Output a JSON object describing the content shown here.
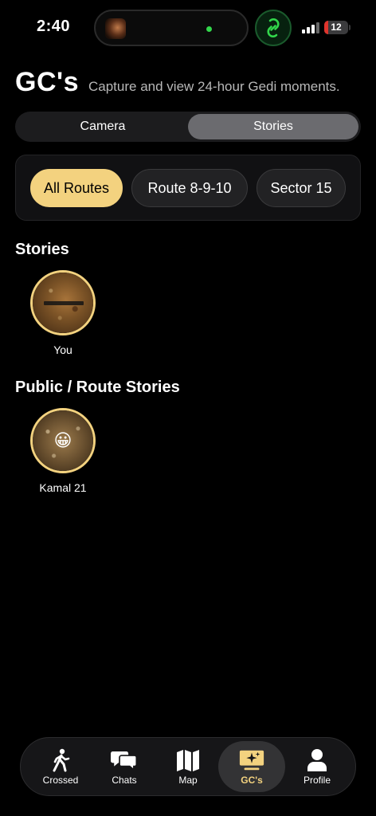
{
  "status_bar": {
    "time": "2:40",
    "battery_level": "12"
  },
  "header": {
    "title": "GC's",
    "subtitle": "Capture and view 24-hour Gedi moments."
  },
  "segmented": {
    "options": [
      "Camera",
      "Stories"
    ],
    "selected": "Stories"
  },
  "filters": {
    "items": [
      "All Routes",
      "Route 8-9-10",
      "Sector 15"
    ],
    "selected": "All Routes"
  },
  "stories_section": {
    "title": "Stories",
    "items": [
      {
        "name": "You"
      }
    ]
  },
  "public_section": {
    "title": "Public / Route Stories",
    "items": [
      {
        "name": "Kamal 21",
        "emoji": "😀"
      }
    ]
  },
  "tabbar": {
    "items": [
      {
        "label": "Crossed",
        "icon": "walking-person-icon"
      },
      {
        "label": "Chats",
        "icon": "chat-bubbles-icon"
      },
      {
        "label": "Map",
        "icon": "map-icon"
      },
      {
        "label": "GC's",
        "icon": "sparkle-screen-icon"
      },
      {
        "label": "Profile",
        "icon": "person-icon"
      }
    ],
    "selected": "GC's"
  },
  "colors": {
    "accent": "#f3d27f",
    "background": "#000000",
    "status_green": "#32d74b",
    "battery_low": "#e0342c"
  }
}
